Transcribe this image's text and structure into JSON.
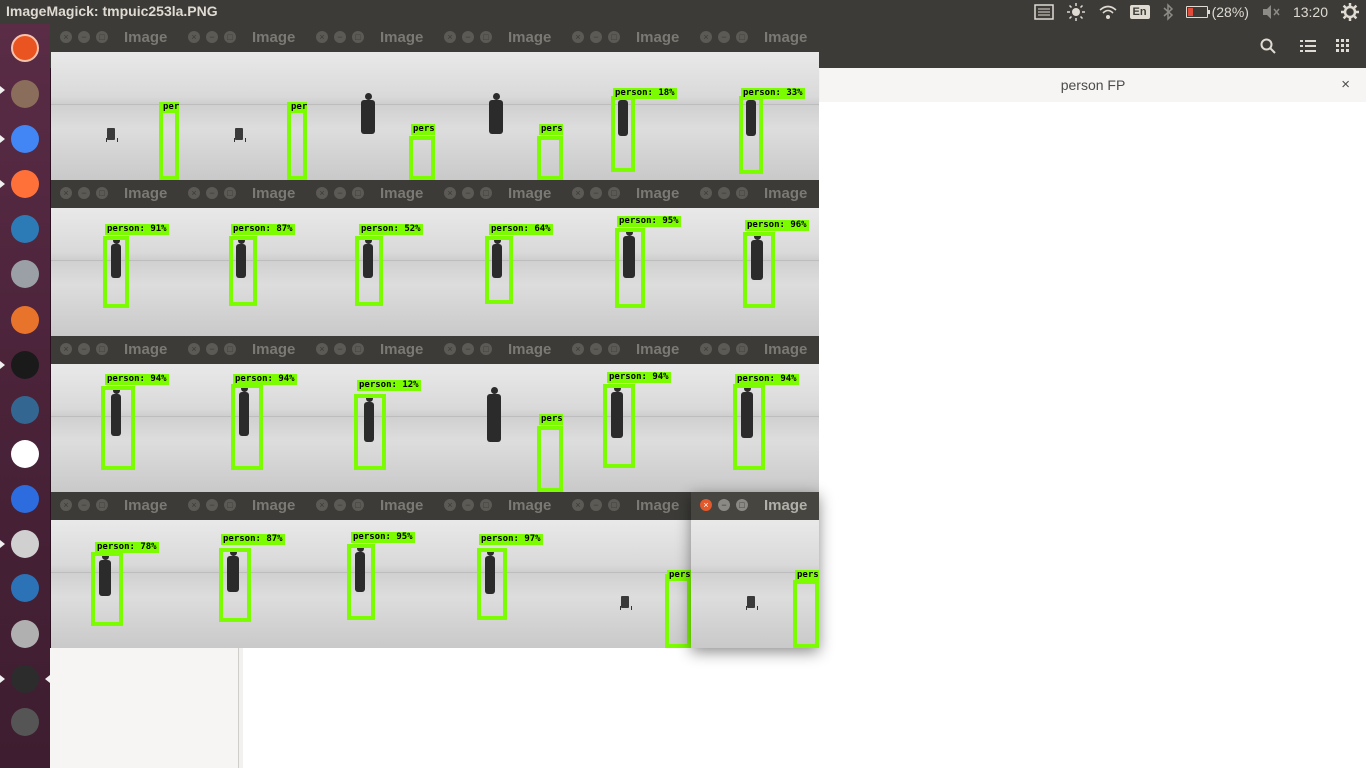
{
  "top_panel": {
    "title": "ImageMagick: tmpuic253la.PNG",
    "battery": "(28%)",
    "time": "13:20",
    "keyboard": "En",
    "battery_level": 0.28,
    "icons": [
      "indicator-menu-icon",
      "brightness-icon",
      "wifi-icon",
      "keyboard-layout-icon",
      "bluetooth-icon",
      "battery-icon",
      "volume-muted-icon",
      "power-gear-icon"
    ]
  },
  "launcher": {
    "items": [
      {
        "name": "ubuntu-dash-icon",
        "color": "#e95420"
      },
      {
        "name": "files-icon",
        "color": "#8a6d5a"
      },
      {
        "name": "chrome-icon",
        "color": "#4285f4"
      },
      {
        "name": "firefox-icon",
        "color": "#ff7139"
      },
      {
        "name": "vpn-client-icon",
        "color": "#2c7bb6"
      },
      {
        "name": "disk-drive-icon",
        "color": "#9aa0a6"
      },
      {
        "name": "software-center-icon",
        "color": "#e8742c"
      },
      {
        "name": "intellij-icon",
        "color": "#1a1a1a"
      },
      {
        "name": "postgresql-elephant-icon",
        "color": "#336791"
      },
      {
        "name": "slack-icon",
        "color": "#ffffff"
      },
      {
        "name": "electron-atom-icon",
        "color": "#2d6cdf"
      },
      {
        "name": "usb-drive-icon",
        "color": "#d0d0d0"
      },
      {
        "name": "musescore-icon",
        "color": "#2b72b7"
      },
      {
        "name": "speaker-volume-icon",
        "color": "#b0b0b0"
      },
      {
        "name": "terminal-icon",
        "color": "#2c2c2c"
      },
      {
        "name": "display-settings-icon",
        "color": "#555555"
      }
    ]
  },
  "background_app": {
    "tab_title": "person FP",
    "tab_close": "×",
    "buttons": [
      "search-icon",
      "list-view-icon",
      "grid-view-icon"
    ]
  },
  "window_title": "Image",
  "window_buttons": {
    "close": "×",
    "minimize": "−",
    "maximize": "□"
  },
  "image_windows": [
    {
      "label": "pers",
      "active": false
    },
    {
      "label": "pers",
      "active": false
    },
    {
      "label": "pers",
      "active": false
    },
    {
      "label": "pers",
      "active": false
    },
    {
      "label": "person: 18%",
      "active": false
    },
    {
      "label": "person: 33%",
      "active": false
    },
    {
      "label": "person: 91%",
      "active": false
    },
    {
      "label": "person: 87%",
      "active": false
    },
    {
      "label": "person: 52%",
      "active": false
    },
    {
      "label": "person: 64%",
      "active": false
    },
    {
      "label": "person: 95%",
      "active": false
    },
    {
      "label": "person: 96%",
      "active": false
    },
    {
      "label": "person: 94%",
      "active": false
    },
    {
      "label": "person: 94%",
      "active": false
    },
    {
      "label": "person: 12%",
      "active": false
    },
    {
      "label": "pers",
      "active": false
    },
    {
      "label": "person: 94%",
      "active": false
    },
    {
      "label": "person: 94%",
      "active": false
    },
    {
      "label": "person: 78%",
      "active": false
    },
    {
      "label": "person: 87%",
      "active": false
    },
    {
      "label": "person: 95%",
      "active": false
    },
    {
      "label": "person: 97%",
      "active": false
    },
    {
      "label": "pers",
      "active": false
    },
    {
      "label": "pers",
      "active": true
    }
  ],
  "colors": {
    "bbox": "#7cfc00",
    "panel": "#3c3b37",
    "launcher": "#4a2339",
    "close_active": "#e3592b"
  }
}
